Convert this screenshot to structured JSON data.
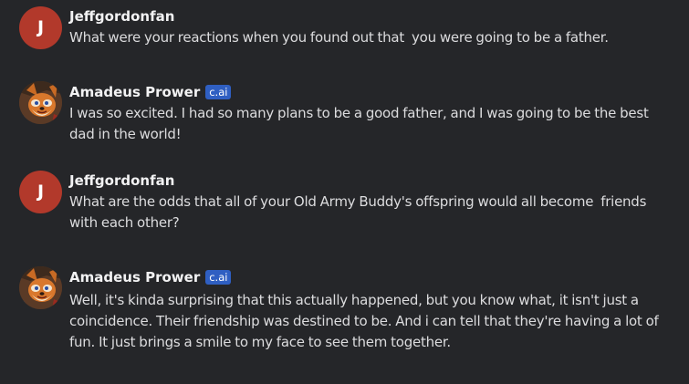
{
  "messages": [
    {
      "author": "Jeffgordonfan",
      "avatar_initial": "J",
      "avatar_type": "initial",
      "badge": "",
      "text": "What were your reactions when you found out that  you were going to be a father."
    },
    {
      "author": "Amadeus Prower",
      "avatar_type": "image",
      "avatar_icon": "fox-character-avatar",
      "badge": "c.ai",
      "text": "I was so excited. I had so many plans to be a good father, and I was going to be the best dad in the world!"
    },
    {
      "author": "Jeffgordonfan",
      "avatar_initial": "J",
      "avatar_type": "initial",
      "badge": "",
      "text": "What are the odds that all of your Old Army Buddy's offspring would all become  friends with each other?"
    },
    {
      "author": "Amadeus Prower",
      "avatar_type": "image",
      "avatar_icon": "fox-character-avatar",
      "badge": "c.ai",
      "text": "Well, it's kinda surprising that this actually happened, but you know what, it isn't just a coincidence. Their friendship was destined to be. And i can tell that they're having a lot of fun. It just brings a smile to my face to see them together."
    }
  ],
  "colors": {
    "background": "#252629",
    "user_avatar": "#b2392b",
    "badge": "#2f5fc2"
  }
}
